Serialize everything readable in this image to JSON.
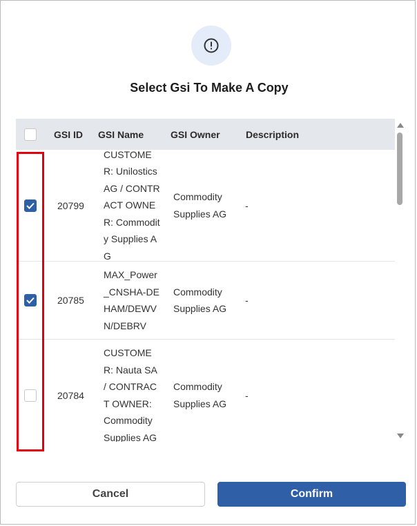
{
  "dialog": {
    "title": "Select Gsi To Make A Copy",
    "icon": "exclamation-circle-icon"
  },
  "table": {
    "columns": [
      "GSI ID",
      "GSI Name",
      "GSI Owner",
      "Description"
    ],
    "rows": [
      {
        "checked": true,
        "id": "20799",
        "name": "CUSTOMER: Unilostics AG / CONTRACT OWNER: Commodity Supplies AG",
        "owner": "Commodity Supplies AG",
        "description": "-"
      },
      {
        "checked": true,
        "id": "20785",
        "name": "MAX_Power_CNSHA-DEHAM/DEWVN/DEBRV",
        "owner": "Commodity Supplies AG",
        "description": "-"
      },
      {
        "checked": false,
        "id": "20784",
        "name": "CUSTOMER: Nauta SA / CONTRACT OWNER: Commodity Supplies AG",
        "owner": "Commodity Supplies AG",
        "description": "-"
      }
    ]
  },
  "buttons": {
    "cancel": "Cancel",
    "confirm": "Confirm"
  },
  "colors": {
    "accent": "#2f5fa7",
    "header_bg": "#e4e7ec",
    "icon_bg": "#e3ecf8",
    "highlight": "#e2000f"
  }
}
